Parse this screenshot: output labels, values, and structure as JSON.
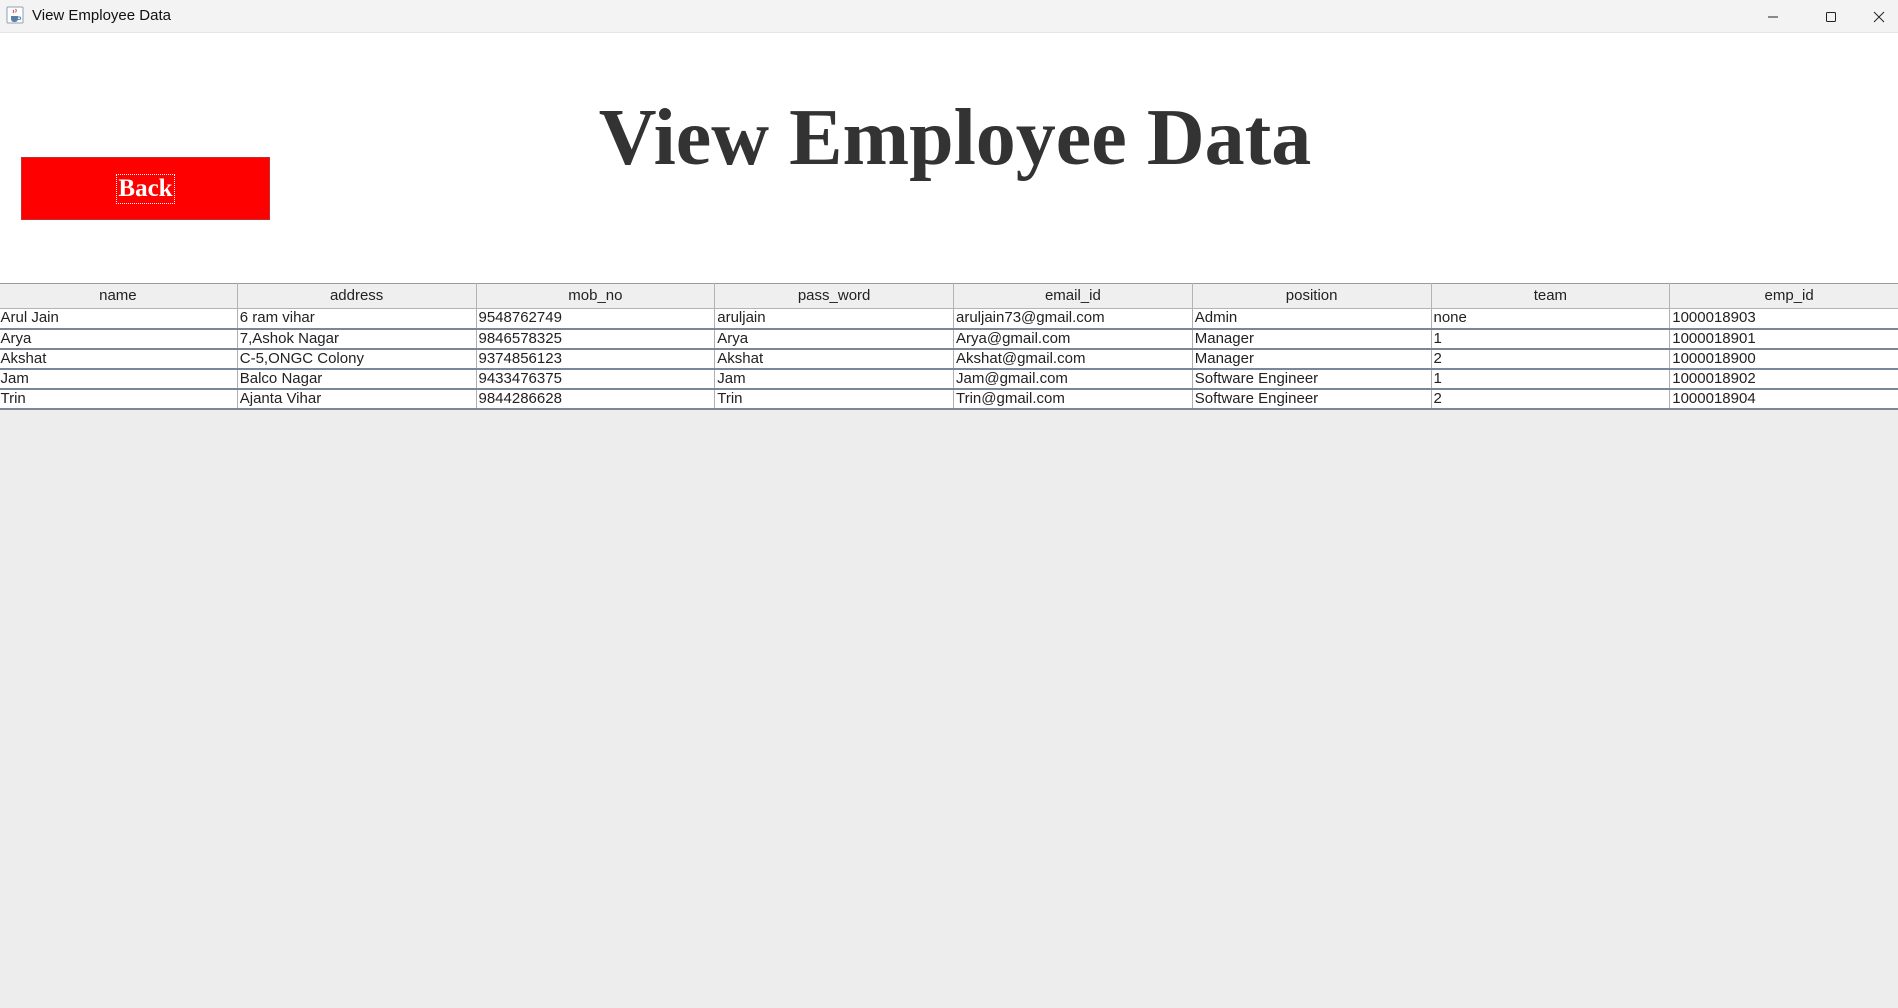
{
  "window": {
    "title": "View Employee Data"
  },
  "header": {
    "title": "View Employee Data",
    "back_label": "Back",
    "back_color": "#ff0000"
  },
  "table": {
    "columns": [
      "name",
      "address",
      "mob_no",
      "pass_word",
      "email_id",
      "position",
      "team",
      "emp_id"
    ],
    "rows": [
      [
        "Arul Jain",
        "6 ram vihar",
        "9548762749",
        "aruljain",
        "aruljain73@gmail.com",
        "Admin",
        "none",
        "1000018903"
      ],
      [
        "Arya",
        "7,Ashok Nagar",
        "9846578325",
        "Arya",
        "Arya@gmail.com",
        "Manager",
        "1",
        "1000018901"
      ],
      [
        "Akshat",
        "C-5,ONGC Colony",
        "9374856123",
        "Akshat",
        "Akshat@gmail.com",
        "Manager",
        "2",
        "1000018900"
      ],
      [
        "Jam",
        "Balco Nagar",
        "9433476375",
        "Jam",
        "Jam@gmail.com",
        "Software Engineer",
        "1",
        "1000018902"
      ],
      [
        "Trin",
        "Ajanta Vihar",
        "9844286628",
        "Trin",
        "Trin@gmail.com",
        "Software Engineer",
        "2",
        "1000018904"
      ]
    ]
  },
  "icons": {
    "app": "java-cup-icon",
    "minimize": "minimize-icon",
    "maximize": "maximize-icon",
    "close": "close-icon"
  }
}
